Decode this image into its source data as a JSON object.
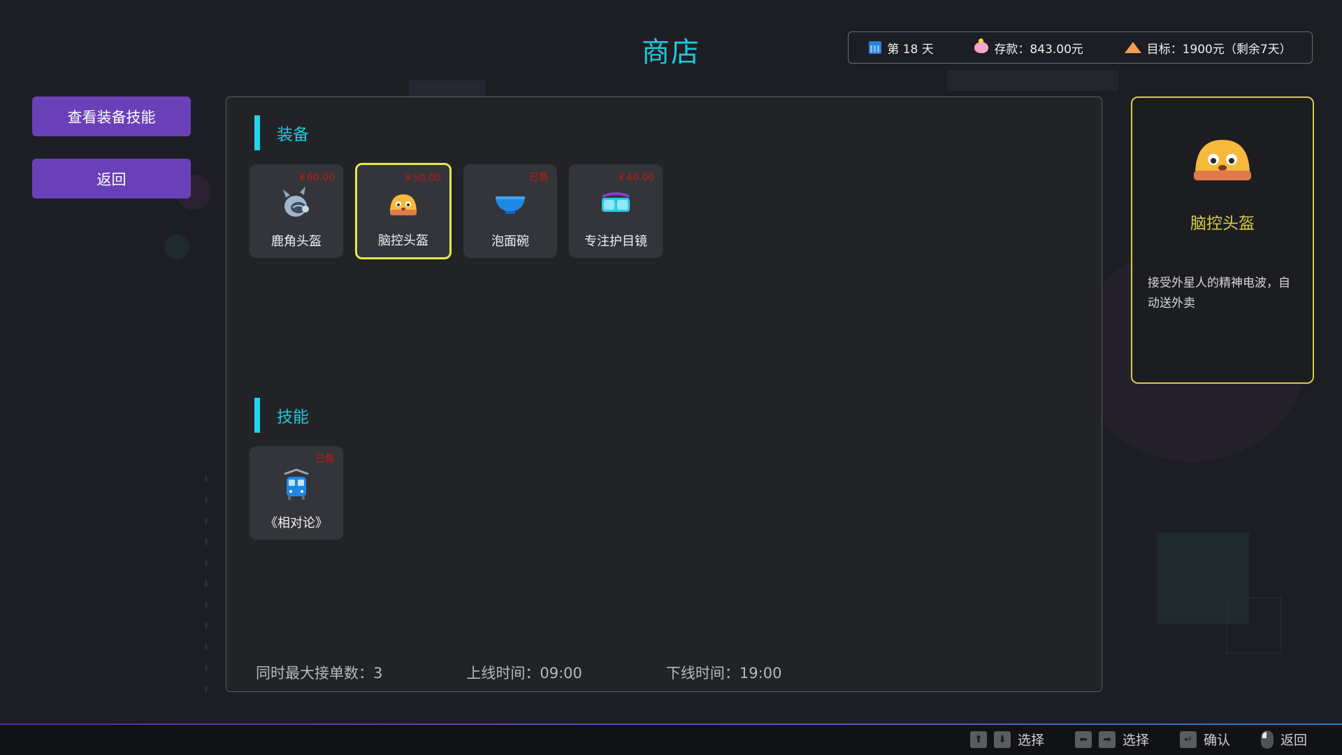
{
  "title": "商店",
  "status": {
    "day": "第 18 天",
    "savings": "存款：843.00元",
    "goal": "目标：1900元（剩余7天）"
  },
  "sidebar": {
    "view_button": "查看装备技能",
    "back_button": "返回"
  },
  "sections": {
    "equipment": {
      "title": "装备",
      "items": [
        {
          "name": "鹿角头盔",
          "price": "￥60.00",
          "icon": "robot-horn-helmet-icon",
          "selected": false
        },
        {
          "name": "脑控头盔",
          "price": "￥50.00",
          "icon": "mind-control-helmet-icon",
          "selected": true
        },
        {
          "name": "泡面碗",
          "price": "已售",
          "icon": "noodle-bowl-icon",
          "selected": false
        },
        {
          "name": "专注护目镜",
          "price": "￥40.00",
          "icon": "focus-goggles-icon",
          "selected": false
        }
      ]
    },
    "skills": {
      "title": "技能",
      "items": [
        {
          "name": "《相对论》",
          "price": "已售",
          "icon": "train-icon",
          "selected": false
        }
      ]
    }
  },
  "footer": {
    "max_orders": "同时最大接单数：3",
    "online_time": "上线时间：09:00",
    "offline_time": "下线时间：19:00"
  },
  "detail": {
    "name": "脑控头盔",
    "description": "接受外星人的精神电波，自动送外卖",
    "icon": "mind-control-helmet-icon"
  },
  "hints": [
    {
      "keys": [
        "up-arrow-key",
        "down-arrow-key"
      ],
      "label": "选择"
    },
    {
      "keys": [
        "left-arrow-key",
        "right-arrow-key"
      ],
      "label": "选择"
    },
    {
      "keys": [
        "enter-key"
      ],
      "label": "确认"
    },
    {
      "keys": [
        "mouse-right-icon"
      ],
      "label": "返回"
    }
  ],
  "colors": {
    "accent": "#1fc9dc",
    "button": "#6a40b8",
    "selected_border": "#e8e84a",
    "price": "#c01818",
    "detail_name": "#d4cc44"
  }
}
